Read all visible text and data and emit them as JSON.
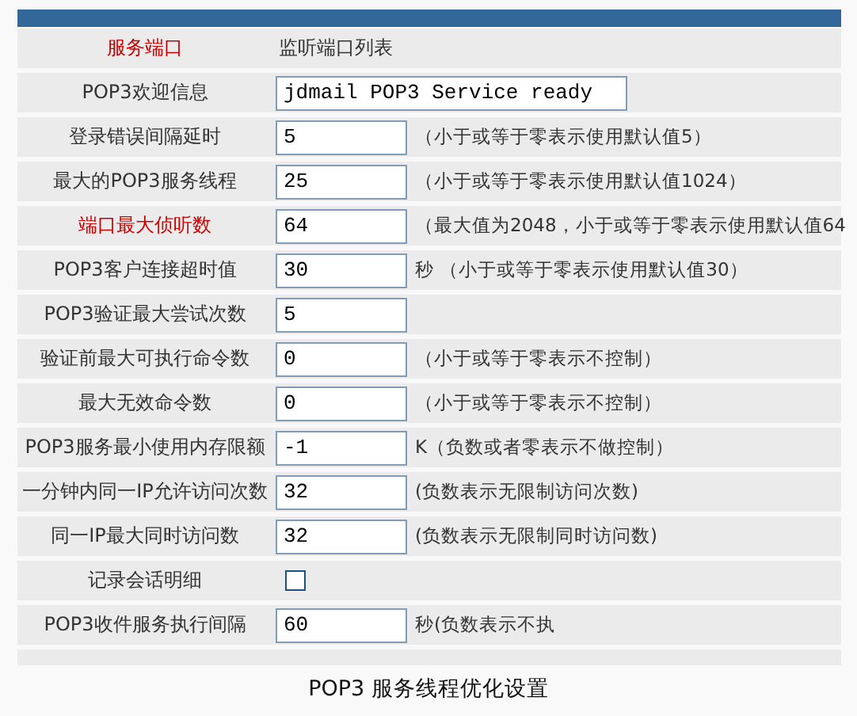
{
  "rows": [
    {
      "kind": "text",
      "label": "服务端口",
      "highlighted": true,
      "value": "监听端口列表"
    },
    {
      "kind": "input",
      "label": "POP3欢迎信息",
      "highlighted": false,
      "value": "jdmail POP3 Service ready",
      "wide": true
    },
    {
      "kind": "input",
      "label": "登录错误间隔延时",
      "highlighted": false,
      "value": "5",
      "hint": "（小于或等于零表示使用默认值5）"
    },
    {
      "kind": "input",
      "label": "最大的POP3服务线程",
      "highlighted": false,
      "value": "25",
      "hint": "（小于或等于零表示使用默认值1024）"
    },
    {
      "kind": "input",
      "label": "端口最大侦听数",
      "highlighted": true,
      "value": "64",
      "hint": "（最大值为2048，小于或等于零表示使用默认值64"
    },
    {
      "kind": "input",
      "label": "POP3客户连接超时值",
      "highlighted": false,
      "value": "30",
      "hint": "秒 （小于或等于零表示使用默认值30）"
    },
    {
      "kind": "input",
      "label": "POP3验证最大尝试次数",
      "highlighted": false,
      "value": "5"
    },
    {
      "kind": "input",
      "label": "验证前最大可执行命令数",
      "highlighted": false,
      "value": "0",
      "hint": "（小于或等于零表示不控制）"
    },
    {
      "kind": "input",
      "label": "最大无效命令数",
      "highlighted": false,
      "value": "0",
      "hint": "（小于或等于零表示不控制）"
    },
    {
      "kind": "input",
      "label": "POP3服务最小使用内存限额",
      "highlighted": false,
      "value": "-1",
      "hint": "K（负数或者零表示不做控制）"
    },
    {
      "kind": "input",
      "label": "一分钟内同一IP允许访问次数",
      "highlighted": false,
      "value": "32",
      "hint": "(负数表示无限制访问次数)"
    },
    {
      "kind": "input",
      "label": "同一IP最大同时访问数",
      "highlighted": false,
      "value": "32",
      "hint": "(负数表示无限制同时访问数)"
    },
    {
      "kind": "checkbox",
      "label": "记录会话明细",
      "highlighted": false,
      "checked": false
    },
    {
      "kind": "input",
      "label": "POP3收件服务执行间隔",
      "highlighted": false,
      "value": "60",
      "hint": "秒(负数表示不执"
    }
  ],
  "caption": "POP3 服务线程优化设置"
}
